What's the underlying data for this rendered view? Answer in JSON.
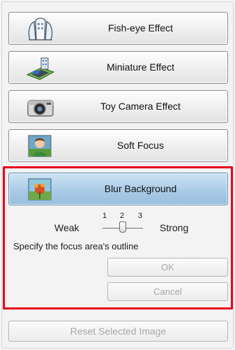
{
  "effects": [
    {
      "label": "Fish-eye Effect",
      "icon": "fisheye-icon"
    },
    {
      "label": "Miniature Effect",
      "icon": "miniature-icon"
    },
    {
      "label": "Toy Camera Effect",
      "icon": "toy-camera-icon"
    },
    {
      "label": "Soft Focus",
      "icon": "soft-focus-icon"
    },
    {
      "label": "Blur Background",
      "icon": "blur-background-icon",
      "selected": true
    }
  ],
  "slider": {
    "weak_label": "Weak",
    "strong_label": "Strong",
    "ticks": [
      "1",
      "2",
      "3"
    ],
    "value": 2
  },
  "instruction": "Specify the focus area's outline",
  "buttons": {
    "ok": "OK",
    "cancel": "Cancel",
    "reset": "Reset Selected Image"
  },
  "colors": {
    "highlight": "#e8001c",
    "selected_button": "#aacbe6"
  }
}
